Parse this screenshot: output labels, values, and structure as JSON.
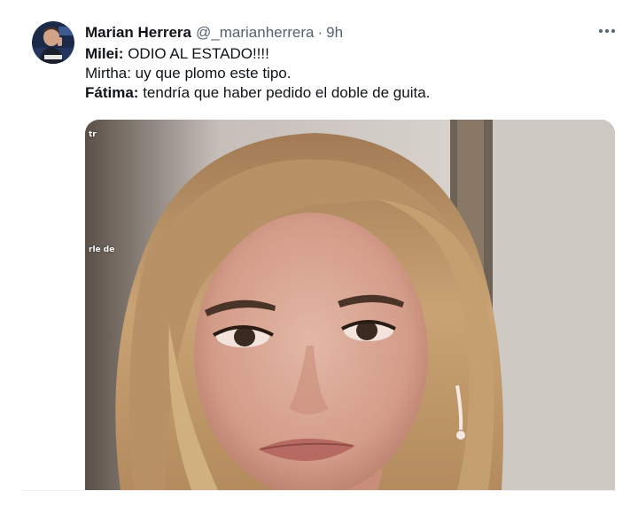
{
  "tweet": {
    "author": {
      "display_name": "Marian Herrera",
      "handle": "@_marianherrera",
      "separator": "·",
      "timestamp": "9h"
    },
    "lines": [
      {
        "speaker": "Milei",
        "sep": ": ",
        "text": "ODIO AL ESTADO!!!!"
      },
      {
        "speaker": "",
        "sep": "",
        "text": "Mirtha: uy que plomo este tipo."
      },
      {
        "speaker": "Fátima",
        "sep": ": ",
        "text": "tendría que haber pedido el doble de guita."
      }
    ],
    "media": {
      "overlay_top": "tr",
      "overlay_mid": "rle de"
    },
    "icons": {
      "more": "more-options-icon"
    }
  },
  "colors": {
    "text_primary": "#0f1419",
    "text_secondary": "#536471",
    "divider": "#eff3f4"
  }
}
